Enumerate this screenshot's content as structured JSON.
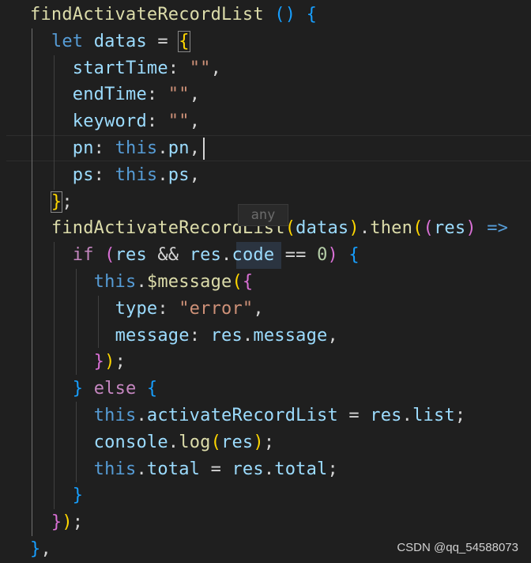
{
  "code_lines": [
    {
      "segments": [
        {
          "text": "findActivateRecordList",
          "cls": "fn"
        },
        {
          "text": " ",
          "cls": "plain"
        },
        {
          "text": "()",
          "cls": "br3"
        },
        {
          "text": " ",
          "cls": "plain"
        },
        {
          "text": "{",
          "cls": "br3"
        }
      ]
    },
    {
      "segments": [
        {
          "text": "  ",
          "cls": "plain"
        },
        {
          "text": "let",
          "cls": "kw"
        },
        {
          "text": " ",
          "cls": "plain"
        },
        {
          "text": "datas",
          "cls": "var"
        },
        {
          "text": " = ",
          "cls": "plain"
        },
        {
          "text": "{",
          "cls": "br1 brbox"
        }
      ]
    },
    {
      "segments": [
        {
          "text": "    ",
          "cls": "plain"
        },
        {
          "text": "startTime",
          "cls": "var"
        },
        {
          "text": ": ",
          "cls": "plain"
        },
        {
          "text": "\"\"",
          "cls": "str"
        },
        {
          "text": ",",
          "cls": "plain"
        }
      ]
    },
    {
      "segments": [
        {
          "text": "    ",
          "cls": "plain"
        },
        {
          "text": "endTime",
          "cls": "var"
        },
        {
          "text": ": ",
          "cls": "plain"
        },
        {
          "text": "\"\"",
          "cls": "str"
        },
        {
          "text": ",",
          "cls": "plain"
        }
      ]
    },
    {
      "segments": [
        {
          "text": "    ",
          "cls": "plain"
        },
        {
          "text": "keyword",
          "cls": "var"
        },
        {
          "text": ": ",
          "cls": "plain"
        },
        {
          "text": "\"\"",
          "cls": "str"
        },
        {
          "text": ",",
          "cls": "plain"
        }
      ]
    },
    {
      "segments": [
        {
          "text": "    ",
          "cls": "plain"
        },
        {
          "text": "pn",
          "cls": "var"
        },
        {
          "text": ": ",
          "cls": "plain"
        },
        {
          "text": "this",
          "cls": "kw"
        },
        {
          "text": ".",
          "cls": "plain"
        },
        {
          "text": "pn",
          "cls": "var"
        },
        {
          "text": ",",
          "cls": "plain"
        }
      ]
    },
    {
      "segments": [
        {
          "text": "    ",
          "cls": "plain"
        },
        {
          "text": "ps",
          "cls": "var"
        },
        {
          "text": ": ",
          "cls": "plain"
        },
        {
          "text": "this",
          "cls": "kw"
        },
        {
          "text": ".",
          "cls": "plain"
        },
        {
          "text": "ps",
          "cls": "var"
        },
        {
          "text": ",",
          "cls": "plain"
        }
      ]
    },
    {
      "segments": [
        {
          "text": "  ",
          "cls": "plain"
        },
        {
          "text": "}",
          "cls": "br1 brbox"
        },
        {
          "text": ";",
          "cls": "plain"
        }
      ]
    },
    {
      "segments": [
        {
          "text": "  ",
          "cls": "plain"
        },
        {
          "text": "findActivateRecordList",
          "cls": "fn"
        },
        {
          "text": "(",
          "cls": "br1"
        },
        {
          "text": "datas",
          "cls": "var"
        },
        {
          "text": ")",
          "cls": "br1"
        },
        {
          "text": ".",
          "cls": "plain"
        },
        {
          "text": "then",
          "cls": "fn"
        },
        {
          "text": "(",
          "cls": "br1"
        },
        {
          "text": "(",
          "cls": "br2"
        },
        {
          "text": "res",
          "cls": "var"
        },
        {
          "text": ")",
          "cls": "br2"
        },
        {
          "text": " ",
          "cls": "plain"
        },
        {
          "text": "=>",
          "cls": "kw"
        }
      ]
    },
    {
      "segments": [
        {
          "text": "    ",
          "cls": "plain"
        },
        {
          "text": "if",
          "cls": "ctrl"
        },
        {
          "text": " ",
          "cls": "plain"
        },
        {
          "text": "(",
          "cls": "br2"
        },
        {
          "text": "res",
          "cls": "var"
        },
        {
          "text": " && ",
          "cls": "plain"
        },
        {
          "text": "res",
          "cls": "var"
        },
        {
          "text": ".",
          "cls": "plain"
        },
        {
          "text": "code",
          "cls": "var"
        },
        {
          "text": " == ",
          "cls": "plain"
        },
        {
          "text": "0",
          "cls": "num"
        },
        {
          "text": ")",
          "cls": "br2"
        },
        {
          "text": " ",
          "cls": "plain"
        },
        {
          "text": "{",
          "cls": "br3"
        }
      ]
    },
    {
      "segments": [
        {
          "text": "      ",
          "cls": "plain"
        },
        {
          "text": "this",
          "cls": "kw"
        },
        {
          "text": ".",
          "cls": "plain"
        },
        {
          "text": "$message",
          "cls": "fn"
        },
        {
          "text": "(",
          "cls": "br1"
        },
        {
          "text": "{",
          "cls": "br2"
        }
      ]
    },
    {
      "segments": [
        {
          "text": "        ",
          "cls": "plain"
        },
        {
          "text": "type",
          "cls": "var"
        },
        {
          "text": ": ",
          "cls": "plain"
        },
        {
          "text": "\"error\"",
          "cls": "str"
        },
        {
          "text": ",",
          "cls": "plain"
        }
      ]
    },
    {
      "segments": [
        {
          "text": "        ",
          "cls": "plain"
        },
        {
          "text": "message",
          "cls": "var"
        },
        {
          "text": ": ",
          "cls": "plain"
        },
        {
          "text": "res",
          "cls": "var"
        },
        {
          "text": ".",
          "cls": "plain"
        },
        {
          "text": "message",
          "cls": "var"
        },
        {
          "text": ",",
          "cls": "plain"
        }
      ]
    },
    {
      "segments": [
        {
          "text": "      ",
          "cls": "plain"
        },
        {
          "text": "}",
          "cls": "br2"
        },
        {
          "text": ")",
          "cls": "br1"
        },
        {
          "text": ";",
          "cls": "plain"
        }
      ]
    },
    {
      "segments": [
        {
          "text": "    ",
          "cls": "plain"
        },
        {
          "text": "}",
          "cls": "br3"
        },
        {
          "text": " ",
          "cls": "plain"
        },
        {
          "text": "else",
          "cls": "ctrl"
        },
        {
          "text": " ",
          "cls": "plain"
        },
        {
          "text": "{",
          "cls": "br3"
        }
      ]
    },
    {
      "segments": [
        {
          "text": "      ",
          "cls": "plain"
        },
        {
          "text": "this",
          "cls": "kw"
        },
        {
          "text": ".",
          "cls": "plain"
        },
        {
          "text": "activateRecordList",
          "cls": "var"
        },
        {
          "text": " = ",
          "cls": "plain"
        },
        {
          "text": "res",
          "cls": "var"
        },
        {
          "text": ".",
          "cls": "plain"
        },
        {
          "text": "list",
          "cls": "var"
        },
        {
          "text": ";",
          "cls": "plain"
        }
      ]
    },
    {
      "segments": [
        {
          "text": "      ",
          "cls": "plain"
        },
        {
          "text": "console",
          "cls": "var"
        },
        {
          "text": ".",
          "cls": "plain"
        },
        {
          "text": "log",
          "cls": "fn"
        },
        {
          "text": "(",
          "cls": "br1"
        },
        {
          "text": "res",
          "cls": "var"
        },
        {
          "text": ")",
          "cls": "br1"
        },
        {
          "text": ";",
          "cls": "plain"
        }
      ]
    },
    {
      "segments": [
        {
          "text": "      ",
          "cls": "plain"
        },
        {
          "text": "this",
          "cls": "kw"
        },
        {
          "text": ".",
          "cls": "plain"
        },
        {
          "text": "total",
          "cls": "var"
        },
        {
          "text": " = ",
          "cls": "plain"
        },
        {
          "text": "res",
          "cls": "var"
        },
        {
          "text": ".",
          "cls": "plain"
        },
        {
          "text": "total",
          "cls": "var"
        },
        {
          "text": ";",
          "cls": "plain"
        }
      ]
    },
    {
      "segments": [
        {
          "text": "    ",
          "cls": "plain"
        },
        {
          "text": "}",
          "cls": "br3"
        }
      ]
    },
    {
      "segments": [
        {
          "text": "  ",
          "cls": "plain"
        },
        {
          "text": "}",
          "cls": "br2"
        },
        {
          "text": ")",
          "cls": "br1"
        },
        {
          "text": ";",
          "cls": "plain"
        }
      ]
    },
    {
      "segments": [
        {
          "text": "}",
          "cls": "br3"
        },
        {
          "text": ",",
          "cls": "plain"
        }
      ]
    }
  ],
  "hover_hint": "any",
  "watermark": "CSDN @qq_54588073",
  "colors": {
    "background": "#1f1f1f",
    "function": "#dcdcaa",
    "keyword": "#569cd6",
    "control": "#c586c0",
    "variable": "#9cdcfe",
    "string": "#ce9178",
    "number": "#b5cea8"
  }
}
